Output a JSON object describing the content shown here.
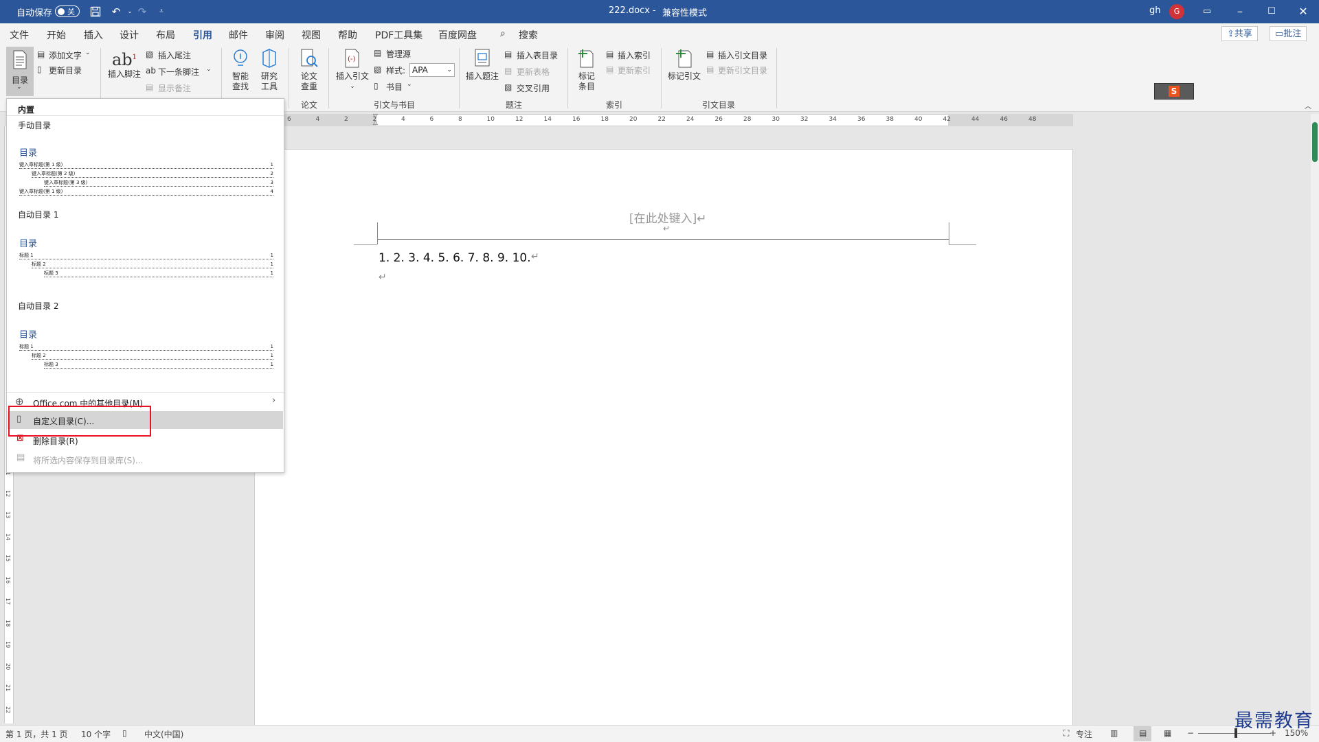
{
  "titlebar": {
    "autosave_label": "自动保存",
    "autosave_state": "关",
    "doc_title": "222.docx",
    "title_sep": "-",
    "mode": "兼容性模式",
    "user": "gh",
    "avatar_initial": "G"
  },
  "menu_tabs": [
    "文件",
    "开始",
    "插入",
    "设计",
    "布局",
    "引用",
    "邮件",
    "审阅",
    "视图",
    "帮助",
    "PDF工具集",
    "百度网盘"
  ],
  "active_tab": "引用",
  "search_label": "搜索",
  "share_label": "共享",
  "comment_label": "批注",
  "ribbon": {
    "toc": "目录",
    "add_text": "添加文字",
    "update_toc": "更新目录",
    "insert_footnote": "插入脚注",
    "insert_endnote": "插入尾注",
    "next_footnote": "下一条脚注",
    "show_notes": "显示备注",
    "smart_lookup_1": "智能",
    "smart_lookup_2": "查找",
    "research_1": "研究",
    "research_2": "工具",
    "paper_check_1": "论文",
    "paper_check_2": "查重",
    "insert_citation": "插入引文",
    "manage_sources": "管理源",
    "style_label": "样式:",
    "style_value": "APA",
    "bibliography": "书目",
    "insert_caption": "插入题注",
    "insert_table_of_figures": "插入表目录",
    "update_table": "更新表格",
    "cross_reference": "交叉引用",
    "mark_entry_1": "标记",
    "mark_entry_2": "条目",
    "insert_index": "插入索引",
    "update_index": "更新索引",
    "mark_citation": "标记引文",
    "insert_toa": "插入引文目录",
    "update_toa": "更新引文目录",
    "group_paper": "论文",
    "group_citations": "引文与书目",
    "group_captions": "题注",
    "group_index": "索引",
    "group_toa": "引文目录"
  },
  "hruler_ticks": [
    "6",
    "4",
    "2",
    "2",
    "4",
    "6",
    "8",
    "10",
    "12",
    "14",
    "16",
    "18",
    "20",
    "22",
    "24",
    "26",
    "28",
    "30",
    "32",
    "34",
    "36",
    "38",
    "40",
    "42",
    "44",
    "46",
    "48"
  ],
  "vruler_ticks": [
    "11",
    "12",
    "13",
    "14",
    "15",
    "16",
    "17",
    "18",
    "19",
    "20",
    "21",
    "22"
  ],
  "document": {
    "header_text": "[在此处键入]↵",
    "header_mark": "↵",
    "line1": "1. 2. 3. 4. 5. 6. 7. 8. 9. 10.",
    "line1_mark": "↵",
    "line2_mark": "↵"
  },
  "dropdown": {
    "builtin": "内置",
    "manual_title": "手动目录",
    "preview_title": "目录",
    "manual_lines": [
      {
        "text": "键入章标题(第 1 级)",
        "page": "1"
      },
      {
        "text": "键入章标题(第 2 级)",
        "page": "2"
      },
      {
        "text": "键入章标题(第 3 级)",
        "page": "3"
      },
      {
        "text": "键入章标题(第 1 级)",
        "page": "4"
      }
    ],
    "auto1_title": "自动目录 1",
    "auto2_title": "自动目录 2",
    "auto_lines": [
      {
        "text": "标题 1",
        "page": "1"
      },
      {
        "text": "标题 2",
        "page": "1"
      },
      {
        "text": "标题 3",
        "page": "1"
      }
    ],
    "office_more": "Office.com 中的其他目录(M)",
    "custom_toc": "自定义目录(C)...",
    "remove_toc": "删除目录(R)",
    "save_selection": "将所选内容保存到目录库(S)..."
  },
  "status": {
    "page": "第 1 页，共 1 页",
    "words": "10 个字",
    "language": "中文(中国)",
    "focus": "专注",
    "zoom": "150%"
  },
  "watermark": "最需教育",
  "colors": {
    "brand": "#2b579a",
    "highlight_box": "#e81123",
    "sogou": "#e8541e"
  }
}
